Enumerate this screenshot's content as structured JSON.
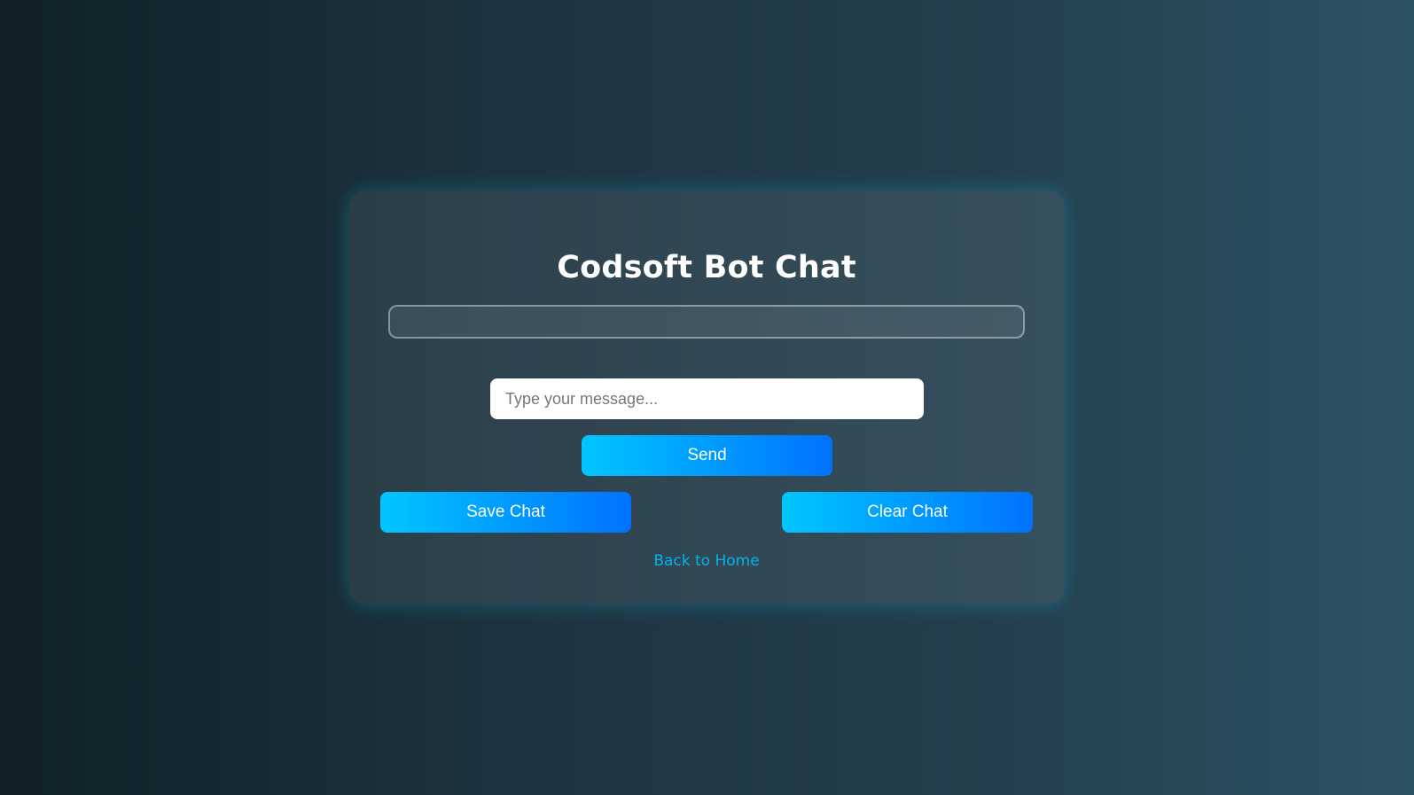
{
  "chat": {
    "title": "Codsoft Bot Chat",
    "input_placeholder": "Type your message...",
    "input_value": "",
    "send_label": "Send",
    "save_label": "Save Chat",
    "clear_label": "Clear Chat",
    "home_link_label": "Back to Home"
  },
  "colors": {
    "background_start": "#0f2027",
    "background_end": "#2c5364",
    "button_gradient_start": "#00c6ff",
    "button_gradient_end": "#0072ff",
    "link": "#00b4f0"
  }
}
